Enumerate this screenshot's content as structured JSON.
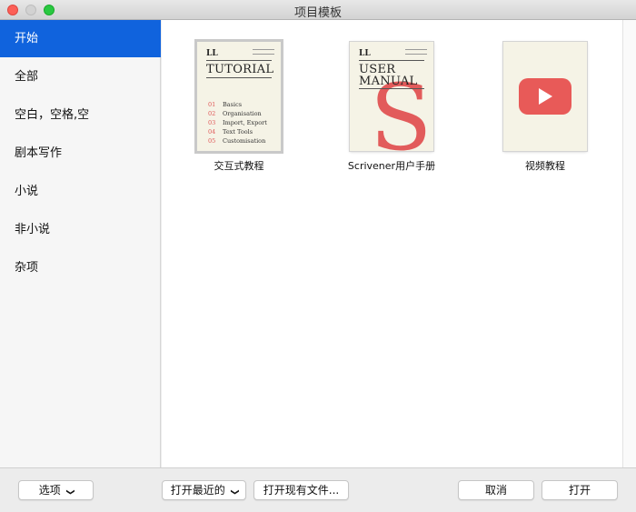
{
  "window": {
    "title": "项目模板"
  },
  "sidebar": {
    "items": [
      {
        "label": "开始",
        "selected": true
      },
      {
        "label": "全部"
      },
      {
        "label": "空白，空格,空"
      },
      {
        "label": "剧本写作"
      },
      {
        "label": "小说"
      },
      {
        "label": "非小说"
      },
      {
        "label": "杂项"
      }
    ]
  },
  "templates": [
    {
      "label": "交互式教程",
      "thumbnail": {
        "logo": "LL",
        "title": "TUTORIAL",
        "toc": [
          {
            "num": "01",
            "text": "Basics"
          },
          {
            "num": "02",
            "text": "Organisation"
          },
          {
            "num": "03",
            "text": "Import, Export"
          },
          {
            "num": "04",
            "text": "Text Tools"
          },
          {
            "num": "05",
            "text": "Customisation"
          }
        ]
      }
    },
    {
      "label": "Scrivener用户手册",
      "thumbnail": {
        "logo": "LL",
        "title_line1": "USER",
        "title_line2": "MANUAL",
        "glyph": "S"
      }
    },
    {
      "label": "视频教程",
      "thumbnail": {
        "icon": "youtube-play-icon"
      }
    }
  ],
  "footer": {
    "options_label": "选项",
    "recent_label": "打开最近的",
    "open_existing_label": "打开现有文件...",
    "cancel_label": "取消",
    "open_label": "打开"
  },
  "colors": {
    "accent": "#1063dd",
    "manual_red": "#e25b5b",
    "video_red": "#e85a58"
  }
}
